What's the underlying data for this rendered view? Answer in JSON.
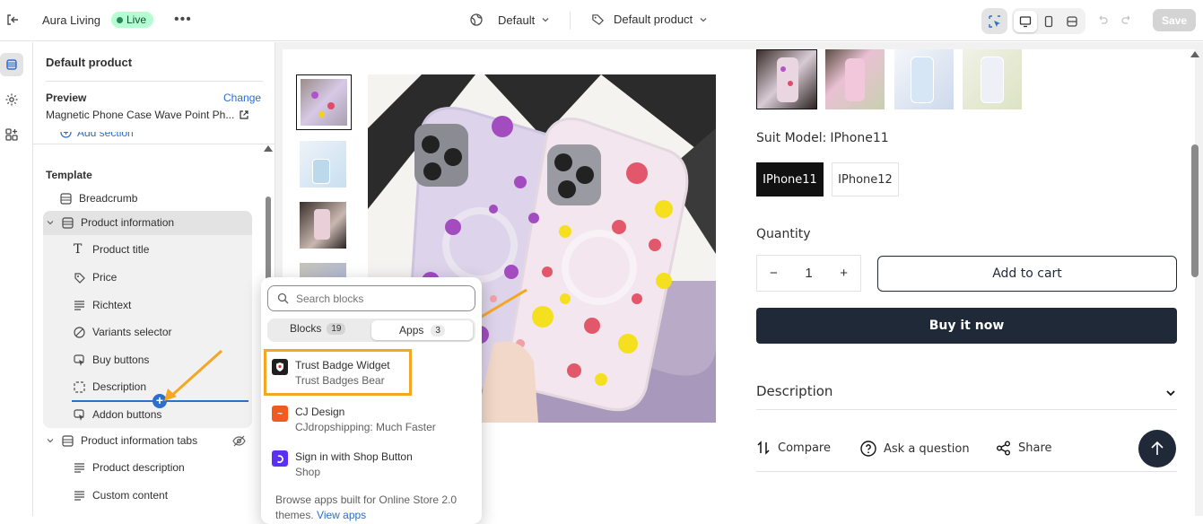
{
  "topbar": {
    "store_name": "Aura Living",
    "live_label": "Live",
    "theme_label": "Default",
    "template_label": "Default product",
    "save_label": "Save"
  },
  "sidebar": {
    "title": "Default product",
    "preview_label": "Preview",
    "change_label": "Change",
    "preview_product": "Magnetic Phone Case Wave Point Ph...",
    "add_section_label": "Add section",
    "template_label": "Template",
    "items": [
      {
        "label": "Breadcrumb",
        "icon": "section-icon"
      },
      {
        "label": "Product information",
        "icon": "section-icon"
      },
      {
        "label": "Product title",
        "icon": "text-icon"
      },
      {
        "label": "Price",
        "icon": "price-icon"
      },
      {
        "label": "Richtext",
        "icon": "richtext-icon"
      },
      {
        "label": "Variants selector",
        "icon": "variants-icon"
      },
      {
        "label": "Buy buttons",
        "icon": "buy-icon"
      },
      {
        "label": "Description",
        "icon": "description-icon"
      },
      {
        "label": "Addon buttons",
        "icon": "buy-icon"
      },
      {
        "label": "Product information tabs",
        "icon": "section-icon"
      },
      {
        "label": "Product description",
        "icon": "richtext-icon"
      },
      {
        "label": "Custom content",
        "icon": "richtext-icon"
      }
    ]
  },
  "popup": {
    "search_placeholder": "Search blocks",
    "tabs": [
      {
        "label": "Blocks",
        "count": "19"
      },
      {
        "label": "Apps",
        "count": "3"
      }
    ],
    "apps": [
      {
        "name": "Trust Badge Widget",
        "vendor": "Trust Badges Bear"
      },
      {
        "name": "CJ Design",
        "vendor": "CJdropshipping: Much Faster"
      },
      {
        "name": "Sign in with Shop Button",
        "vendor": "Shop"
      }
    ],
    "footer_text": "Browse apps built for Online Store 2.0 themes.",
    "footer_link": "View apps"
  },
  "product": {
    "suit_model_label": "Suit Model:",
    "suit_model_value": "IPhone11",
    "variants": [
      "IPhone11",
      "IPhone12"
    ],
    "quantity_label": "Quantity",
    "quantity_value": "1",
    "add_to_cart_label": "Add to cart",
    "buy_now_label": "Buy it now",
    "description_label": "Description",
    "compare_label": "Compare",
    "ask_label": "Ask a question",
    "share_label": "Share"
  },
  "colors": {
    "accent": "#2c6ecb",
    "highlight": "#f5a623",
    "dark_button": "#1f2937",
    "live_bg": "#b4fed2"
  }
}
